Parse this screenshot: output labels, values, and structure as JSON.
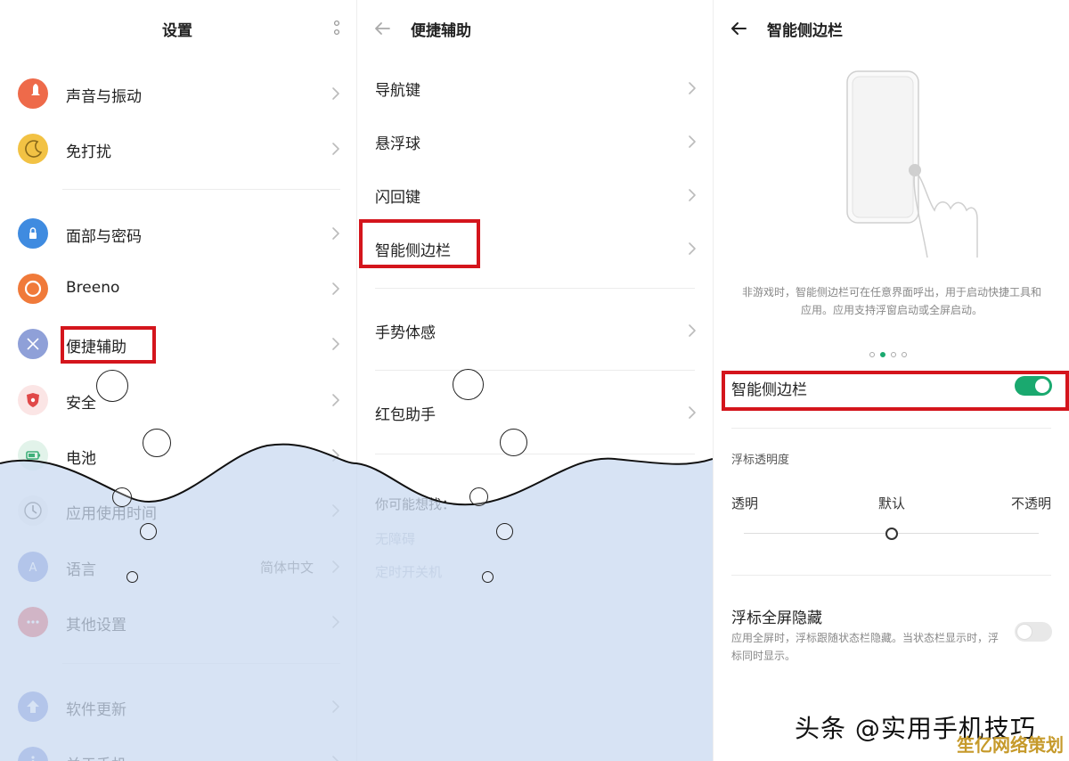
{
  "panel1": {
    "title": "设置",
    "items": [
      {
        "label": "声音与振动",
        "icon": "bell-icon",
        "color": "#ee6a4a"
      },
      {
        "label": "免打扰",
        "icon": "moon-icon",
        "color": "#f2c244"
      },
      {
        "label": "面部与密码",
        "icon": "lock-icon",
        "color": "#3f8be0"
      },
      {
        "label": "Breeno",
        "icon": "breeno-icon",
        "color": "#f07a3a"
      },
      {
        "label": "便捷辅助",
        "icon": "assist-icon",
        "color": "#8fa0d8"
      },
      {
        "label": "安全",
        "icon": "shield-icon",
        "color": "#e04848"
      },
      {
        "label": "电池",
        "icon": "battery-icon",
        "color": "#3fb07a"
      },
      {
        "label": "应用使用时间",
        "icon": "clock-icon",
        "color": "#444444"
      },
      {
        "label": "语言",
        "icon": "language-icon",
        "color": "#6f86d6",
        "value": "简体中文"
      },
      {
        "label": "其他设置",
        "icon": "more-dots-icon",
        "color": "#e54848"
      },
      {
        "label": "软件更新",
        "icon": "update-icon",
        "color": "#6f86d6"
      },
      {
        "label": "关于手机",
        "icon": "info-icon",
        "color": "#6f86d6"
      }
    ]
  },
  "panel2": {
    "title": "便捷辅助",
    "items": [
      "导航键",
      "悬浮球",
      "闪回键",
      "智能侧边栏",
      "手势体感",
      "红包助手"
    ],
    "suggest_title": "你可能想找：",
    "suggest_items": [
      "无障碍",
      "定时开关机"
    ]
  },
  "panel3": {
    "title": "智能侧边栏",
    "caption": "非游戏时，智能侧边栏可在任意界面呼出，用于启动快捷工具和应用。应用支持浮窗启动或全屏启动。",
    "toggle_label": "智能侧边栏",
    "toggle_on": true,
    "opacity_title": "浮标透明度",
    "opacity_labels": [
      "透明",
      "默认",
      "不透明"
    ],
    "opacity_level": 0.5,
    "hide_title": "浮标全屏隐藏",
    "hide_desc": "应用全屏时，浮标跟随状态栏隐藏。当状态栏显示时，浮标同时显示。",
    "hide_on": false,
    "accent": "#1aa96f"
  },
  "watermark": "头条 @实用手机技巧",
  "watermark2": "笙亿网络策划",
  "highlight_color": "#d4151c"
}
